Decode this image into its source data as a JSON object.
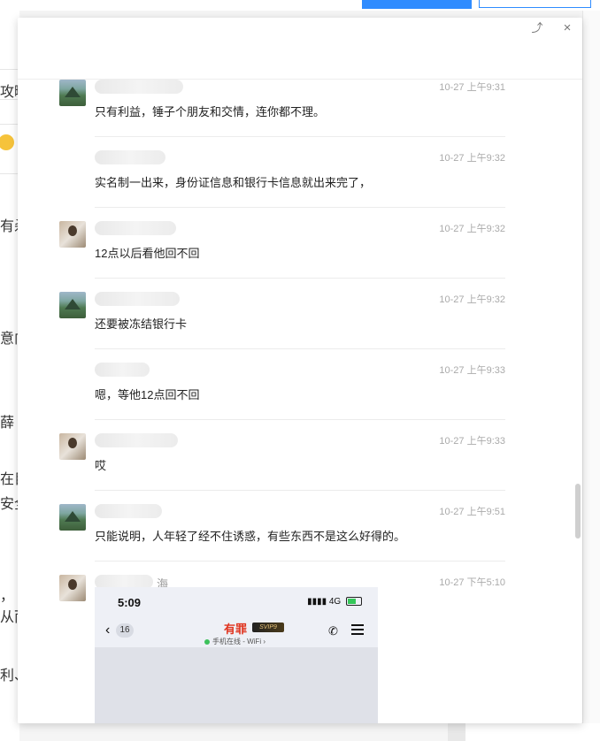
{
  "background": {
    "fragments": [
      "攻略",
      "有杀",
      "意向",
      "薛",
      "在目",
      "安全",
      "，",
      "从而",
      "利、"
    ]
  },
  "dialog": {
    "icons": {
      "share": "share-icon",
      "close": "close-icon"
    },
    "share_glyph": "⤴",
    "close_glyph": "×"
  },
  "messages": [
    {
      "avatar": "landscape",
      "sender": "",
      "time": "10-27 上午9:31",
      "text": "只有利益，锤子个朋友和交情，连你都不理。"
    },
    {
      "avatar": "none",
      "sender": "",
      "time": "10-27 上午9:32",
      "text": "实名制一出来，身份证信息和银行卡信息就出来完了，"
    },
    {
      "avatar": "person",
      "sender": "",
      "time": "10-27 上午9:32",
      "text": "12点以后看他回不回"
    },
    {
      "avatar": "landscape",
      "sender": "",
      "time": "10-27 上午9:32",
      "text": "还要被冻结银行卡"
    },
    {
      "avatar": "none",
      "sender": "",
      "time": "10-27 上午9:33",
      "text": "嗯，等他12点回不回"
    },
    {
      "avatar": "person",
      "sender": "",
      "time": "10-27 上午9:33",
      "text": "哎"
    },
    {
      "avatar": "landscape",
      "sender": "",
      "time": "10-27 上午9:51",
      "text": "只能说明，人年轻了经不住诱惑，有些东西不是这么好得的。"
    },
    {
      "avatar": "person",
      "sender": "海",
      "time": "10-27 下午5:10",
      "text": ""
    }
  ],
  "phone_screenshot": {
    "time": "5:09",
    "network": "4G",
    "badge": "16",
    "title": "有罪",
    "vip": "SVIP9",
    "status": "手机在线 - WiFi"
  }
}
